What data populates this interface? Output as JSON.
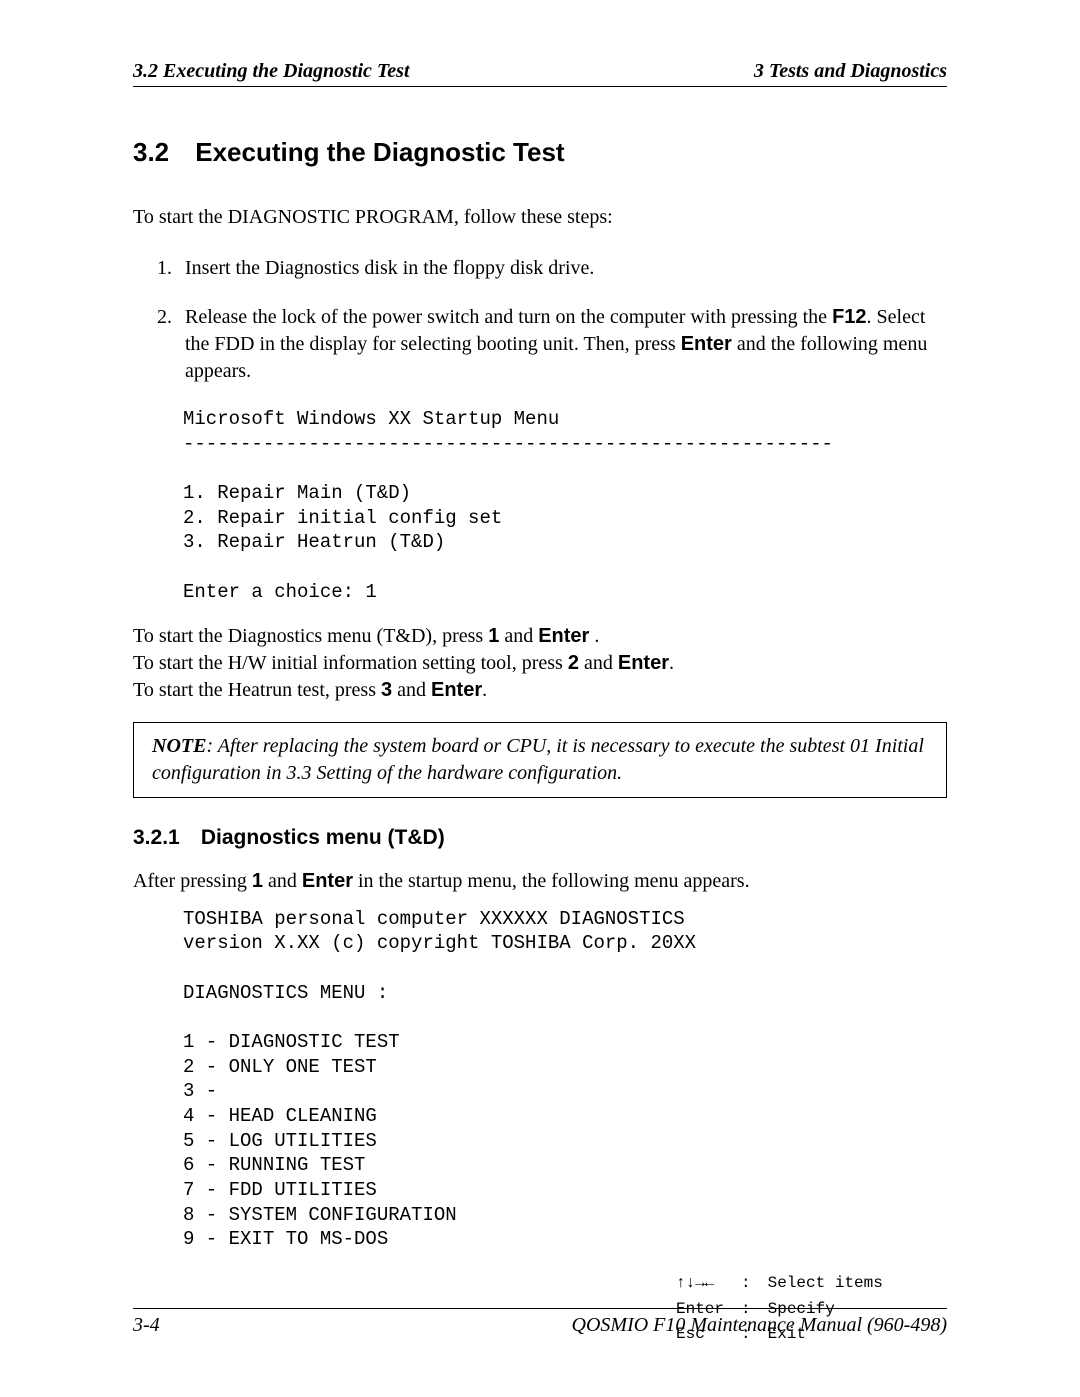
{
  "header": {
    "left": "3.2  Executing the Diagnostic Test",
    "right": "3  Tests and Diagnostics"
  },
  "section": {
    "number": "3.2",
    "title": "Executing the Diagnostic Test"
  },
  "intro": "To start the DIAGNOSTIC PROGRAM, follow these steps:",
  "steps": {
    "s1": "Insert the Diagnostics disk in the floppy disk drive.",
    "s2_a": "Release the lock of the power switch and turn on the computer with pressing the ",
    "s2_key1": "F12",
    "s2_b": ". Select the FDD in the display for selecting booting unit. Then, press ",
    "s2_key2": "Enter",
    "s2_c": " and the following menu appears."
  },
  "startup_menu": "Microsoft Windows XX Startup Menu\n---------------------------------------------------------\n\n1. Repair Main (T&D)\n2. Repair initial config set\n3. Repair Heatrun (T&D)\n\nEnter a choice: 1",
  "post_steps": {
    "l1a": "To start the Diagnostics menu (T&D), press ",
    "l1k1": "1",
    "l1b": " and ",
    "l1k2": "Enter",
    "l1c": " .",
    "l2a": "To start the H/W initial information setting tool, press ",
    "l2k1": "2",
    "l2b": " and ",
    "l2k2": "Enter",
    "l2c": ".",
    "l3a": "To start the Heatrun test, press ",
    "l3k1": "3",
    "l3b": " and ",
    "l3k2": "Enter",
    "l3c": "."
  },
  "note": {
    "label": "NOTE",
    "text": ": After replacing the system board or CPU, it is necessary to execute the subtest 01 Initial configuration in 3.3 Setting of the hardware configuration."
  },
  "subsection": {
    "number": "3.2.1",
    "title": "Diagnostics menu (T&D)"
  },
  "after_press": {
    "a": "After pressing ",
    "k1": "1",
    "b": " and ",
    "k2": "Enter",
    "c": " in the startup menu, the following menu appears."
  },
  "diag_menu": "TOSHIBA personal computer XXXXXX DIAGNOSTICS\nversion X.XX (c) copyright TOSHIBA Corp. 20XX\n\nDIAGNOSTICS MENU :\n\n1 - DIAGNOSTIC TEST\n2 - ONLY ONE TEST\n3 -\n4 - HEAD CLEANING\n5 - LOG UTILITIES\n6 - RUNNING TEST\n7 - FDD UTILITIES\n8 - SYSTEM CONFIGURATION\n9 - EXIT TO MS-DOS",
  "legend": {
    "r1a": "↑↓→←",
    "r1b": ":",
    "r1c": "Select items",
    "r2a": "Enter",
    "r2b": ":",
    "r2c": "Specify",
    "r3a": "Esc",
    "r3b": ":",
    "r3c": "Exit"
  },
  "footer": {
    "left": "3-4",
    "right": "QOSMIO F10 Maintenance Manual (960-498)"
  }
}
